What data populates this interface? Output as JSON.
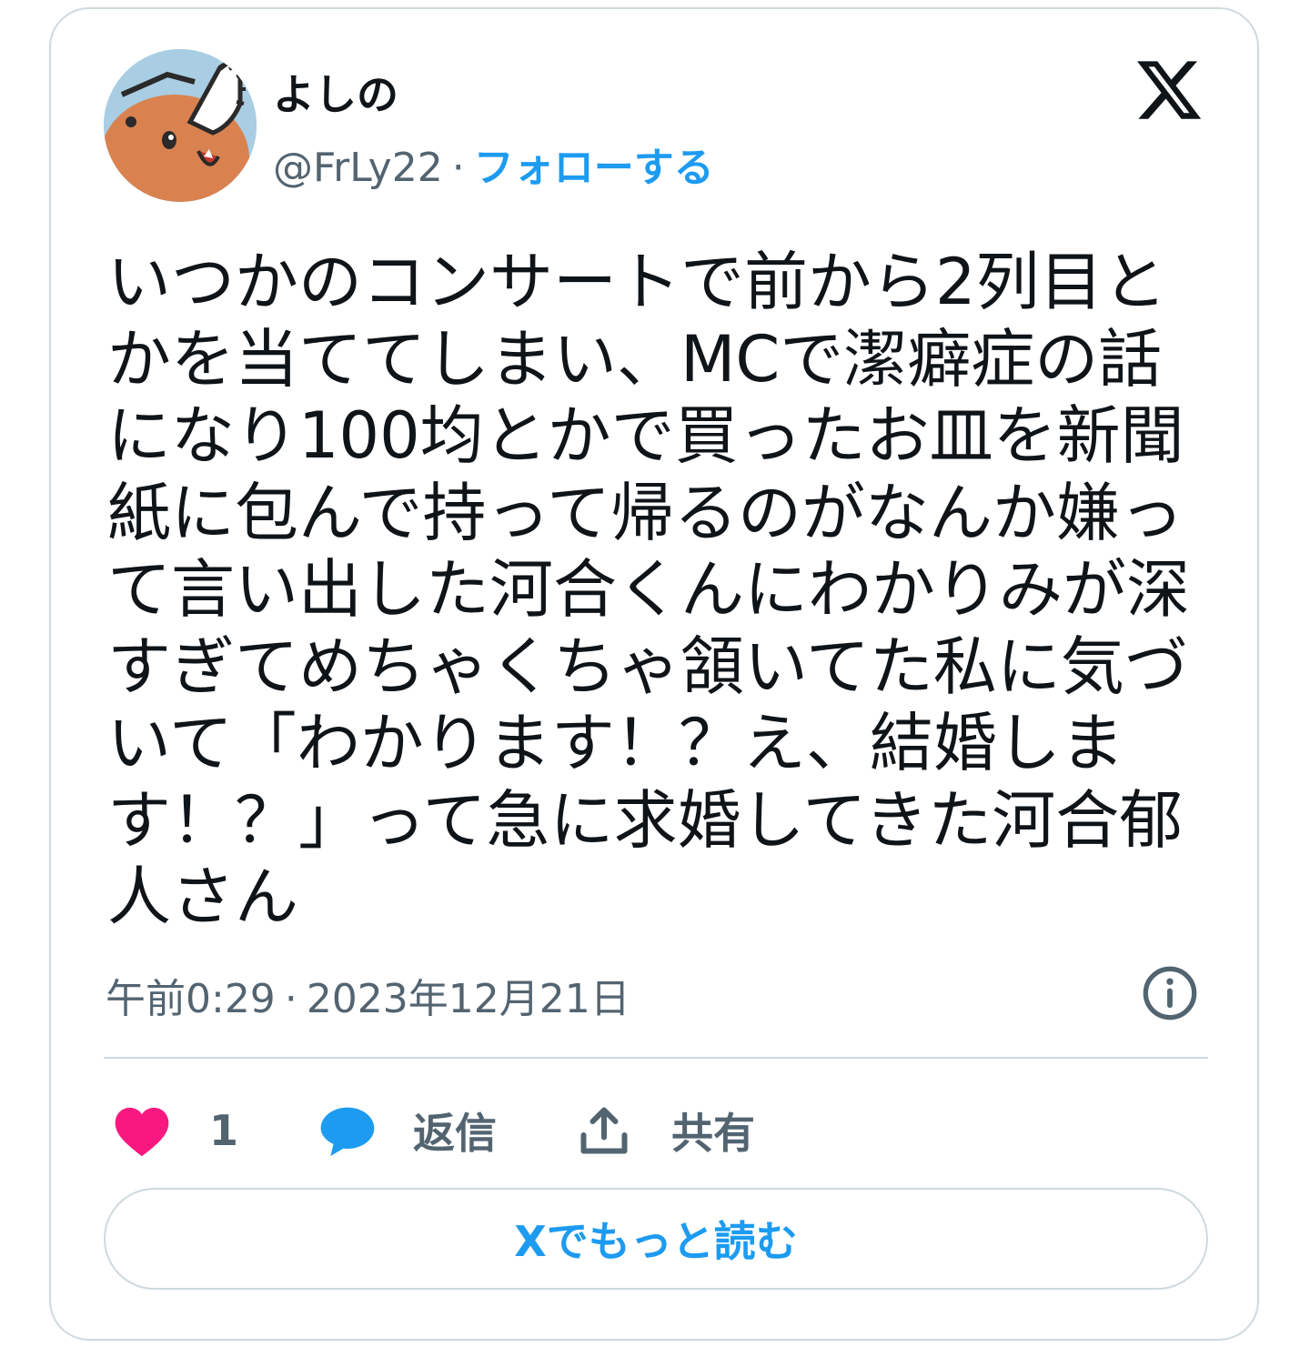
{
  "user": {
    "display_name": "よしの",
    "handle": "@FrLy22",
    "separator": "·",
    "follow_label": "フォローする"
  },
  "tweet": {
    "lines": [
      "いつかのコンサートで前から2列目と",
      "かを当ててしまい、MCで潔癖症の話",
      "になり100均とかで買ったお皿を新聞",
      "紙に包んで持って帰るのがなんか嫌っ",
      "て言い出した河合くんにわかりみが深",
      "すぎてめちゃくちゃ頷いてた私に気づ",
      "いて「わかります！？え、結婚しま",
      "す！？」って急に求婚してきた河合郁",
      "人さん"
    ],
    "time": "午前0:29",
    "date": "2023年12月21日"
  },
  "actions": {
    "like_count": "1",
    "reply_label": "返信",
    "share_label": "共有"
  },
  "read_more_label": "Xでもっと読む",
  "colors": {
    "accent": "#1d9bf0",
    "like": "#f91880",
    "secondary_text": "#536471",
    "border": "#cfd9de"
  },
  "icons": {
    "logo": "x-logo-icon",
    "info": "info-icon",
    "like": "heart-icon",
    "reply": "speech-bubble-icon",
    "share": "share-upload-icon"
  }
}
